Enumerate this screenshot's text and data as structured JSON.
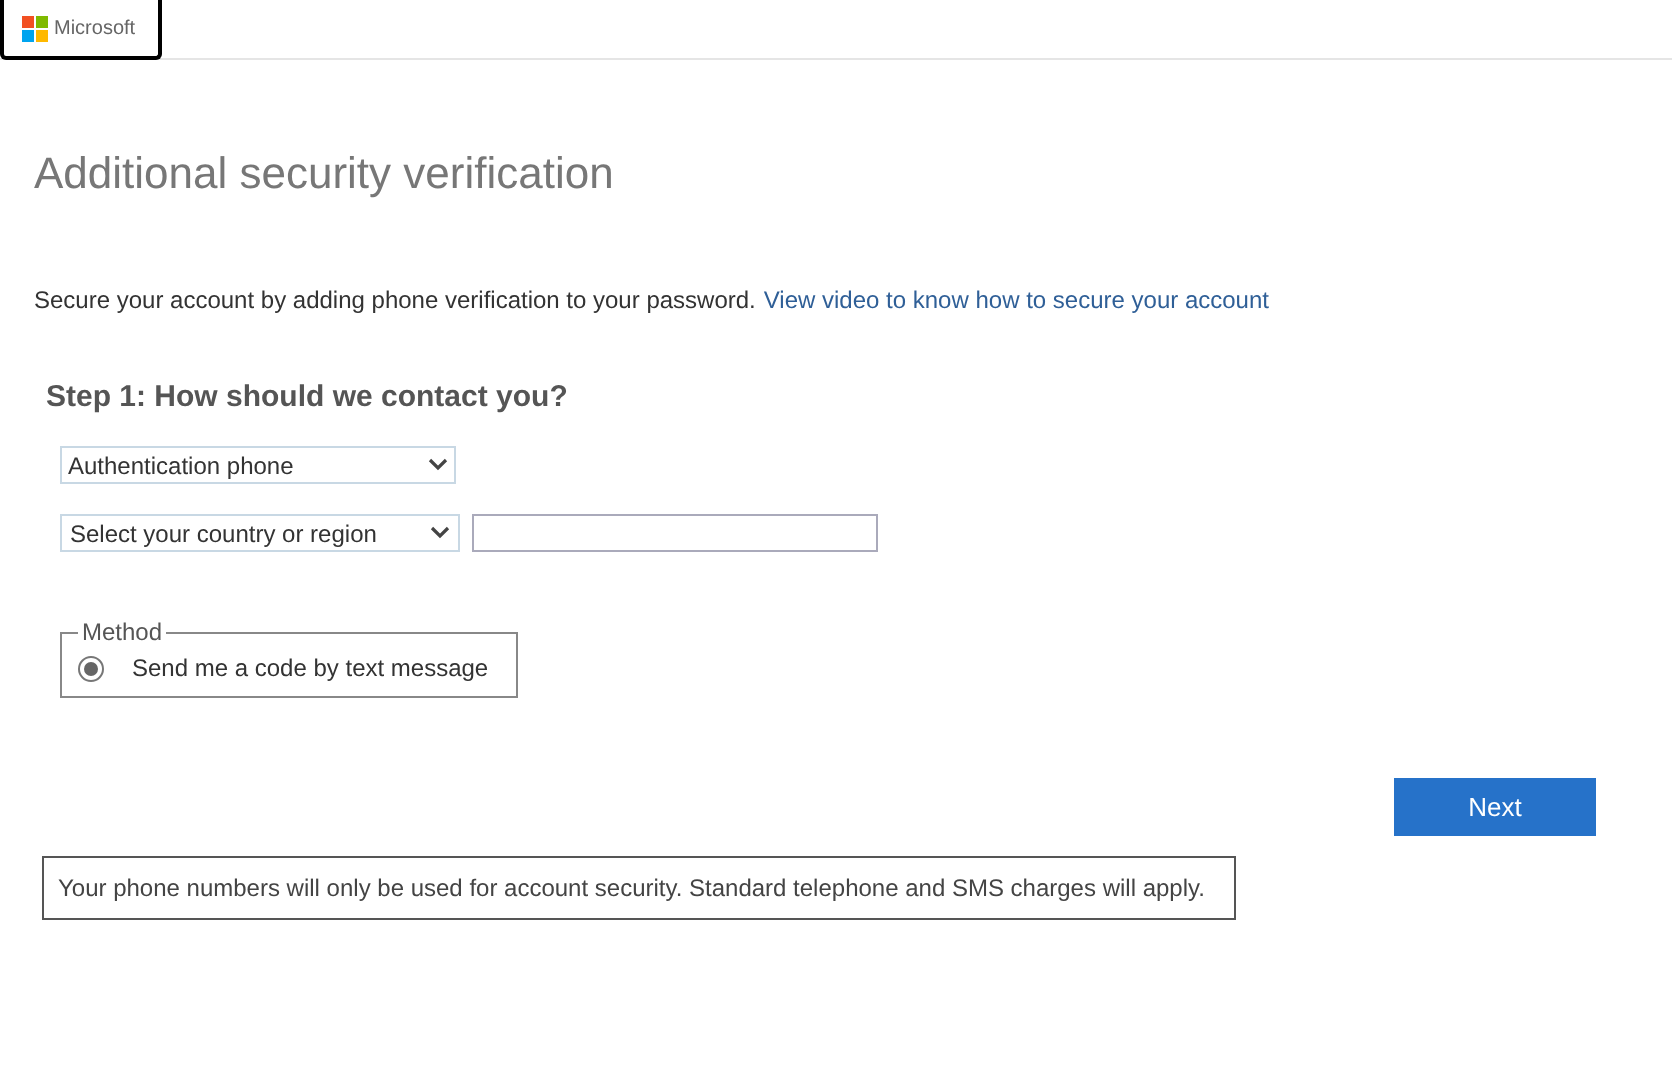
{
  "header": {
    "logo_text": "Microsoft"
  },
  "title": "Additional security verification",
  "intro": {
    "text": "Secure your account by adding phone verification to your password.",
    "link": "View video to know how to secure your account"
  },
  "step": {
    "heading": "Step 1: How should we contact you?",
    "contact_method": {
      "value": "Authentication phone"
    },
    "country": {
      "value": "Select your country or region"
    },
    "method": {
      "legend": "Method",
      "options": [
        {
          "label": "Send me a code by text message",
          "selected": true
        }
      ]
    }
  },
  "next_button": "Next",
  "notice": "Your phone numbers will only be used for account security. Standard telephone and SMS charges will apply."
}
